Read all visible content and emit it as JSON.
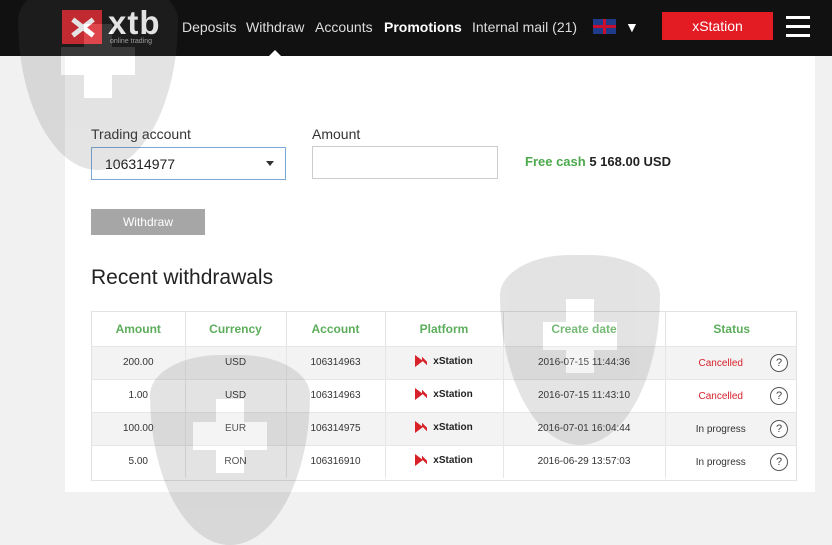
{
  "brand": {
    "name": "xtb",
    "tagline": "online trading"
  },
  "nav": {
    "items": [
      "Deposits",
      "Withdraw",
      "Accounts",
      "Promotions",
      "Internal mail"
    ],
    "mail_count": "(21)",
    "language_caret": "▼",
    "xstation_label": "xStation"
  },
  "form": {
    "trading_account_label": "Trading account",
    "trading_account_value": "106314977",
    "amount_label": "Amount",
    "amount_value": "",
    "free_cash_label": "Free cash",
    "free_cash_value": "5 168.00 USD",
    "withdraw_label": "Withdraw"
  },
  "recent": {
    "title": "Recent withdrawals",
    "columns": [
      "Amount",
      "Currency",
      "Account",
      "Platform",
      "Create date",
      "Status"
    ],
    "help_glyph": "?",
    "rows": [
      {
        "amount": "200.00",
        "currency": "USD",
        "account": "106314963",
        "platform": "xStation",
        "date": "2016-07-15 11:44:36",
        "status": "Cancelled"
      },
      {
        "amount": "1.00",
        "currency": "USD",
        "account": "106314963",
        "platform": "xStation",
        "date": "2016-07-15 11:43:10",
        "status": "Cancelled"
      },
      {
        "amount": "100.00",
        "currency": "EUR",
        "account": "106314975",
        "platform": "xStation",
        "date": "2016-07-01 16:04:44",
        "status": "In progress"
      },
      {
        "amount": "5.00",
        "currency": "RON",
        "account": "106316910",
        "platform": "xStation",
        "date": "2016-06-29 13:57:03",
        "status": "In progress"
      }
    ]
  },
  "colors": {
    "brand_red": "#e31b23",
    "accent_green": "#5cad5c",
    "navbar": "#111111"
  }
}
